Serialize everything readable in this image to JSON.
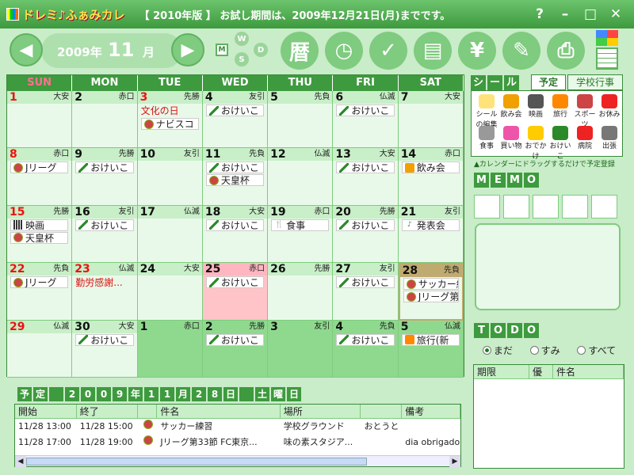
{
  "app": {
    "title": "ドレミ♪ふぁみカレ",
    "trial": "【 2010年版 】 お試し期間は、2009年12月21日(月)までです。"
  },
  "window": {
    "help": "?",
    "minimize": "–",
    "maximize": "□",
    "close": "✕"
  },
  "header": {
    "year": "2009年",
    "month": "11",
    "month_unit": "月",
    "prev": "◀",
    "next": "▶"
  },
  "views": {
    "m": "M",
    "w": "W",
    "s": "S",
    "d": "D"
  },
  "tools": {
    "koyomi": "暦",
    "clock": "◷",
    "check": "✓",
    "book": "▤",
    "yen": "¥",
    "wrench": "✎",
    "print": "⎙"
  },
  "weekdays": [
    "SUN",
    "MON",
    "TUE",
    "WED",
    "THU",
    "FRI",
    "SAT"
  ],
  "weeks": [
    [
      {
        "d": "1",
        "r": "大安",
        "t": "sun",
        "ev": []
      },
      {
        "d": "2",
        "r": "赤口",
        "ev": []
      },
      {
        "d": "3",
        "r": "先勝",
        "t": "hol",
        "hol": "文化の日",
        "ev": [
          {
            "ic": "ball",
            "tx": "ナビスコ"
          }
        ]
      },
      {
        "d": "4",
        "r": "友引",
        "ev": [
          {
            "ic": "pencil",
            "tx": "おけいこ"
          }
        ]
      },
      {
        "d": "5",
        "r": "先負",
        "ev": []
      },
      {
        "d": "6",
        "r": "仏滅",
        "ev": [
          {
            "ic": "pencil",
            "tx": "おけいこ"
          }
        ]
      },
      {
        "d": "7",
        "r": "大安",
        "ev": []
      }
    ],
    [
      {
        "d": "8",
        "r": "赤口",
        "t": "sun",
        "ev": [
          {
            "ic": "ball",
            "tx": "Jリーグ"
          }
        ]
      },
      {
        "d": "9",
        "r": "先勝",
        "ev": [
          {
            "ic": "pencil",
            "tx": "おけいこ"
          }
        ]
      },
      {
        "d": "10",
        "r": "友引",
        "ev": []
      },
      {
        "d": "11",
        "r": "先負",
        "ev": [
          {
            "ic": "pencil",
            "tx": "おけいこ"
          },
          {
            "ic": "ball",
            "tx": "天皇杯"
          }
        ]
      },
      {
        "d": "12",
        "r": "仏滅",
        "ev": []
      },
      {
        "d": "13",
        "r": "大安",
        "ev": [
          {
            "ic": "pencil",
            "tx": "おけいこ"
          }
        ]
      },
      {
        "d": "14",
        "r": "赤口",
        "ev": [
          {
            "ic": "beer",
            "tx": "飲み会"
          }
        ]
      }
    ],
    [
      {
        "d": "15",
        "r": "先勝",
        "t": "sun",
        "ev": [
          {
            "ic": "film",
            "tx": "映画"
          },
          {
            "ic": "ball",
            "tx": "天皇杯"
          }
        ]
      },
      {
        "d": "16",
        "r": "友引",
        "ev": [
          {
            "ic": "pencil",
            "tx": "おけいこ"
          }
        ]
      },
      {
        "d": "17",
        "r": "仏滅",
        "ev": []
      },
      {
        "d": "18",
        "r": "大安",
        "ev": [
          {
            "ic": "pencil",
            "tx": "おけいこ"
          }
        ]
      },
      {
        "d": "19",
        "r": "赤口",
        "ev": [
          {
            "ic": "cook",
            "tx": "食事"
          }
        ]
      },
      {
        "d": "20",
        "r": "先勝",
        "ev": [
          {
            "ic": "pencil",
            "tx": "おけいこ"
          }
        ]
      },
      {
        "d": "21",
        "r": "友引",
        "ev": [
          {
            "ic": "note",
            "tx": "発表会"
          }
        ]
      }
    ],
    [
      {
        "d": "22",
        "r": "先負",
        "t": "sun",
        "ev": [
          {
            "ic": "ball",
            "tx": "Jリーグ"
          }
        ]
      },
      {
        "d": "23",
        "r": "仏滅",
        "t": "hol",
        "hol": "勤労感謝...",
        "ev": []
      },
      {
        "d": "24",
        "r": "大安",
        "ev": []
      },
      {
        "d": "25",
        "r": "赤口",
        "t": "today",
        "ev": [
          {
            "ic": "pencil",
            "tx": "おけいこ"
          }
        ]
      },
      {
        "d": "26",
        "r": "先勝",
        "ev": []
      },
      {
        "d": "27",
        "r": "友引",
        "ev": [
          {
            "ic": "pencil",
            "tx": "おけいこ"
          }
        ]
      },
      {
        "d": "28",
        "r": "先負",
        "t": "sel",
        "ev": [
          {
            "ic": "ball",
            "tx": "サッカー練"
          },
          {
            "ic": "ball",
            "tx": "Jリーグ第"
          }
        ]
      }
    ],
    [
      {
        "d": "29",
        "r": "仏滅",
        "t": "sun",
        "ev": []
      },
      {
        "d": "30",
        "r": "大安",
        "ev": [
          {
            "ic": "pencil",
            "tx": "おけいこ"
          }
        ]
      },
      {
        "d": "1",
        "r": "赤口",
        "t": "other",
        "ev": []
      },
      {
        "d": "2",
        "r": "先勝",
        "t": "other",
        "ev": [
          {
            "ic": "pencil",
            "tx": "おけいこ"
          }
        ]
      },
      {
        "d": "3",
        "r": "友引",
        "t": "other",
        "ev": []
      },
      {
        "d": "4",
        "r": "先負",
        "t": "other",
        "ev": [
          {
            "ic": "pencil",
            "tx": "おけいこ"
          }
        ]
      },
      {
        "d": "5",
        "r": "仏滅",
        "t": "other",
        "ev": [
          {
            "ic": "bag",
            "tx": "旅行(新"
          }
        ]
      }
    ]
  ],
  "panel": {
    "seal": [
      "シ",
      "ー",
      "ル"
    ],
    "tab_yotei": "予定",
    "tab_gakko": "学校行事",
    "stickers_row1": [
      {
        "l": "シール の編集",
        "c": "#ffe37a"
      },
      {
        "l": "飲み会",
        "c": "#f0a000"
      },
      {
        "l": "映画",
        "c": "#555"
      },
      {
        "l": "旅行",
        "c": "#f80"
      },
      {
        "l": "スポーツ",
        "c": "#c44"
      },
      {
        "l": "お休み",
        "c": "#e22"
      }
    ],
    "stickers_row2": [
      {
        "l": "食事",
        "c": "#999"
      },
      {
        "l": "買い物",
        "c": "#e5a"
      },
      {
        "l": "おでかけ",
        "c": "#fc0"
      },
      {
        "l": "おけいこ",
        "c": "#2a8a2a"
      },
      {
        "l": "病院",
        "c": "#e22"
      },
      {
        "l": "出張",
        "c": "#777"
      }
    ],
    "drag_hint": "▲カレンダーにドラッグするだけで予定登録",
    "memo": [
      "M",
      "E",
      "M",
      "O"
    ],
    "todo": [
      "T",
      "O",
      "D",
      "O"
    ],
    "filter_pending": "まだ",
    "filter_done": "すみ",
    "filter_all": "すべて",
    "todo_cols": [
      "期限",
      "優",
      "件名"
    ]
  },
  "detail": {
    "title": [
      "予",
      "定",
      "",
      "2",
      "0",
      "0",
      "9",
      "年",
      "1",
      "1",
      "月",
      "2",
      "8",
      "日",
      "",
      "土",
      "曜",
      "日"
    ],
    "cols": [
      "開始",
      "終了",
      "",
      "件名",
      "場所",
      "",
      "備考"
    ],
    "rows": [
      [
        "11/28 13:00",
        "11/28 15:00",
        "サッカー練習",
        "学校グラウンド",
        "おとうと",
        ""
      ],
      [
        "11/28 17:00",
        "11/28 19:00",
        "Jリーグ第33節 FC東京...",
        "味の素スタジア...",
        "",
        "dia obrigado"
      ]
    ]
  }
}
